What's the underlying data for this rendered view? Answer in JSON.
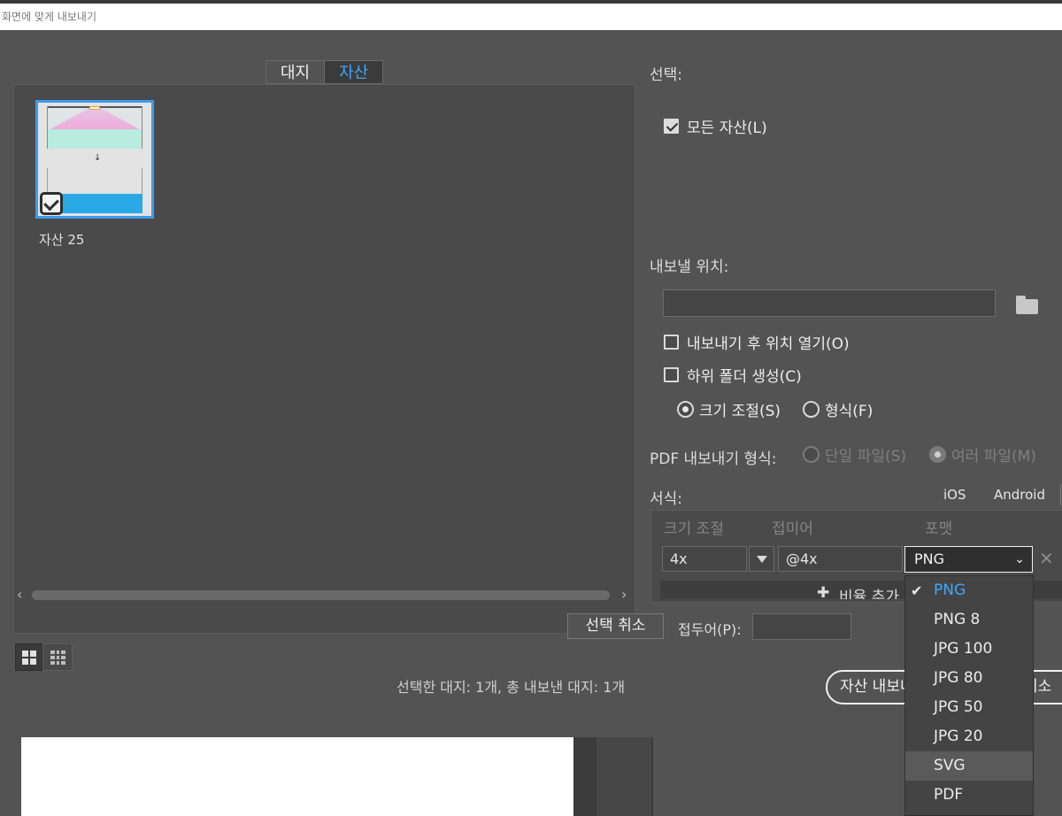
{
  "window": {
    "title": "화면에 맞게 내보내기"
  },
  "tabs": [
    {
      "label": "대지",
      "active": false
    },
    {
      "label": "자산",
      "active": true
    }
  ],
  "assets": [
    {
      "label": "자산 25",
      "checked": true
    }
  ],
  "bottom": {
    "deselect_label": "선택 취소",
    "prefix_label": "접두어(P):",
    "prefix_value": "",
    "status": "선택한 대지: 1개, 총 내보낸 대지: 1개",
    "export_label": "자산 내보내기",
    "cancel_label": "취소"
  },
  "right": {
    "select_label": "선택:",
    "all_assets_label": "모든 자산(L)",
    "all_assets_checked": true,
    "export_location_label": "내보낼 위치:",
    "export_location_value": "",
    "open_after_label": "내보내기 후 위치 열기(O)",
    "open_after_checked": false,
    "subfolder_label": "하위 폴더 생성(C)",
    "subfolder_checked": false,
    "scale_radio_label": "크기 조절(S)",
    "format_radio_label": "형식(F)",
    "pdf_label": "PDF 내보내기 형식:",
    "pdf_single_label": "단일 파일(S)",
    "pdf_multi_label": "여러 파일(M)",
    "formats_label": "서식:",
    "ios_label": "iOS",
    "android_label": "Android"
  },
  "format_table": {
    "headers": {
      "scale": "크기 조절",
      "suffix": "접미어",
      "format": "포맷"
    },
    "row": {
      "scale": "4x",
      "suffix": "@4x",
      "format": "PNG"
    },
    "add_scale_label": "비율 추가"
  },
  "format_menu": {
    "options": [
      "PNG",
      "PNG 8",
      "JPG 100",
      "JPG 80",
      "JPG 50",
      "JPG 20",
      "SVG",
      "PDF"
    ],
    "selected": "PNG",
    "hovered": "SVG"
  },
  "colors": {
    "accent": "#3ea6ff",
    "dialog_bg": "#535353",
    "panel_bg": "#4a4a4a",
    "asset_blue": "#29a9e6",
    "asset_mint": "#b8ecde",
    "asset_pink": "#f0a8dc"
  },
  "icons": [
    "checkbox-icon",
    "folder-icon",
    "chevron-down-icon",
    "close-icon",
    "grid-view-icon",
    "list-view-icon",
    "plus-icon",
    "checkmark-icon",
    "scroll-left-icon",
    "scroll-right-icon"
  ]
}
